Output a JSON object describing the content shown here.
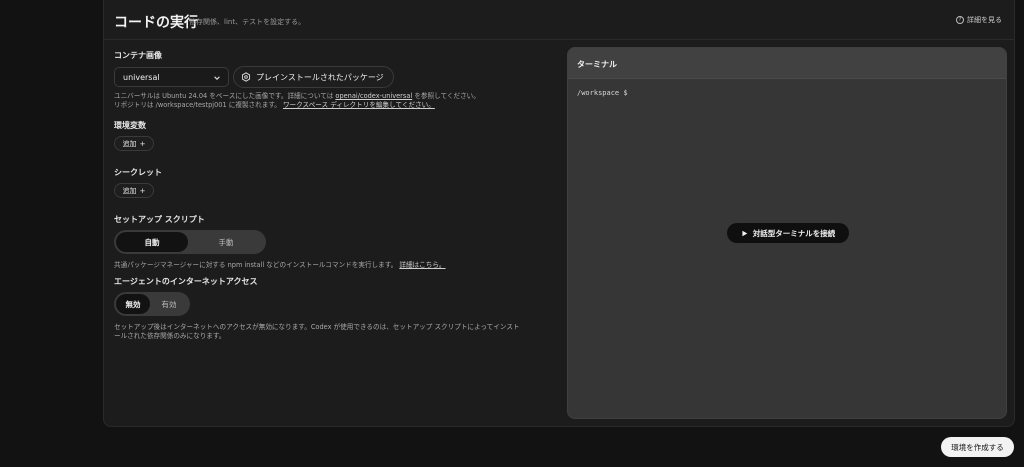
{
  "header": {
    "title": "コードの実行",
    "subtitle": "依存関係、lint、テストを設定する。",
    "details_link": "詳細を見る"
  },
  "container_image": {
    "label": "コンテナ画像",
    "selected": "universal",
    "preinstalled_button": "プレインストールされたパッケージ",
    "help_line1_pre": "ユニバーサルは Ubuntu 24.04 をベースにした画像です。詳細については",
    "help_link": "openai/codex-universal",
    "help_line1_post": "を参照してください。",
    "help_line2_pre": "リポジトリは /workspace/testpj001 に複製されます。",
    "help_line2_link": "ワークスペース ディレクトリを編集してください。"
  },
  "env_vars": {
    "label": "環境変数",
    "add_button": "追加"
  },
  "secrets": {
    "label": "シークレット",
    "add_button": "追加"
  },
  "setup_script": {
    "label": "セットアップ スクリプト",
    "options": [
      "自動",
      "手動"
    ],
    "help_pre": "共通パッケージマネージャーに対する npm install などのインストールコマンドを実行します。",
    "help_link": "詳細はこちら。"
  },
  "internet_access": {
    "label": "エージェントのインターネットアクセス",
    "options": [
      "無効",
      "有効"
    ],
    "help_line1": "セットアップ後はインターネットへのアクセスが無効になります。Codex が使用できるのは、セットアップ スクリプトによってインスト",
    "help_line2": "ールされた依存関係のみになります。"
  },
  "terminal": {
    "title": "ターミナル",
    "prompt": "/workspace $",
    "connect_button": "対話型ターミナルを接続"
  },
  "footer": {
    "create_button": "環境を作成する"
  }
}
